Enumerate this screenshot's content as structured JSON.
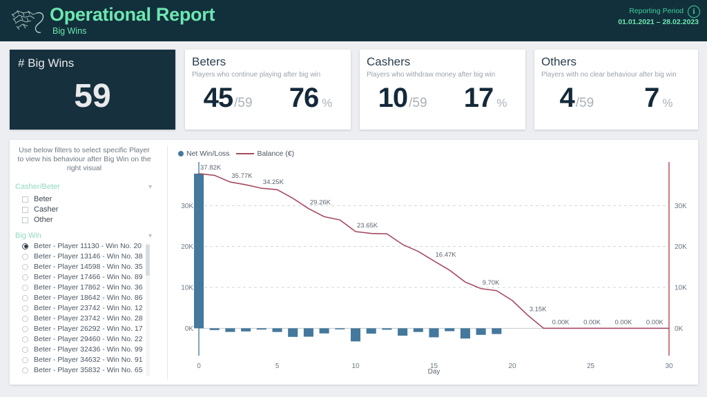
{
  "header": {
    "title": "Operational Report",
    "subtitle": "Big Wins",
    "logo_icon": "gecko-logo-icon",
    "reporting_period_label": "Reporting Period",
    "reporting_period_dates": "01.01.2021 – 28.02.2023",
    "info_icon": "i",
    "bg_color": "#12303c",
    "accent_color": "#6ee7b0"
  },
  "kpis": [
    {
      "title": "# Big Wins",
      "value": "59",
      "style": "dark"
    },
    {
      "title": "Beters",
      "subtitle": "Players who continue playing after big win",
      "count": "45",
      "count_unit": "/59",
      "percent": "76",
      "percent_unit": "%"
    },
    {
      "title": "Cashers",
      "subtitle": "Players who withdraw money after big win",
      "count": "10",
      "count_unit": "/59",
      "percent": "17",
      "percent_unit": "%"
    },
    {
      "title": "Others",
      "subtitle": "Players with no clear behaviour after big win",
      "count": "4",
      "count_unit": "/59",
      "percent": "7",
      "percent_unit": "%"
    }
  ],
  "filters": {
    "help_text": "Use below filters to select specific Player to view his behaviour after Big Win on the right visual",
    "groups": [
      {
        "label": "Casher/Beter",
        "chevron_icon": "chevron-down-icon",
        "options": [
          {
            "label": "Beter",
            "checked": false
          },
          {
            "label": "Casher",
            "checked": false
          },
          {
            "label": "Other",
            "checked": false
          }
        ]
      },
      {
        "label": "Big Win",
        "chevron_icon": "chevron-down-icon",
        "options": [
          {
            "label": "Beter - Player 11130 - Win No. 20",
            "selected": true
          },
          {
            "label": "Beter - Player 13146 - Win No. 38",
            "selected": false
          },
          {
            "label": "Beter - Player 14598 - Win No. 35",
            "selected": false
          },
          {
            "label": "Beter - Player 17466 - Win No. 89",
            "selected": false
          },
          {
            "label": "Beter - Player 17862 - Win No. 36",
            "selected": false
          },
          {
            "label": "Beter - Player 18642 - Win No. 86",
            "selected": false
          },
          {
            "label": "Beter - Player 23742 - Win No. 12",
            "selected": false
          },
          {
            "label": "Beter - Player 23742 - Win No. 28",
            "selected": false
          },
          {
            "label": "Beter - Player 26292 - Win No. 17",
            "selected": false
          },
          {
            "label": "Beter - Player 29460 - Win No. 22",
            "selected": false
          },
          {
            "label": "Beter - Player 32436 - Win No. 99",
            "selected": false
          },
          {
            "label": "Beter - Player 34632 - Win No. 91",
            "selected": false
          },
          {
            "label": "Beter - Player 35832 - Win No. 65",
            "selected": false
          }
        ]
      }
    ]
  },
  "chart_data": {
    "type": "bar",
    "title": "",
    "xlabel": "Day",
    "ylabel": "",
    "xlim": [
      0,
      30
    ],
    "ylim": [
      -5000,
      40000
    ],
    "xticks": [
      0,
      5,
      10,
      15,
      20,
      25,
      30
    ],
    "yticks": [
      0,
      10000,
      20000,
      30000
    ],
    "ytick_labels": [
      "0K",
      "10K",
      "20K",
      "30K"
    ],
    "right_ytick_labels": [
      "0K",
      "10K",
      "20K",
      "30K"
    ],
    "grid": true,
    "legend_position": "top-left",
    "bar_color": "#44789c",
    "line_color": "#a44a60",
    "series": [
      {
        "name": "Net Win/Loss",
        "type": "bar",
        "x": [
          0,
          1,
          2,
          3,
          4,
          5,
          6,
          7,
          8,
          9,
          10,
          11,
          12,
          13,
          14,
          15,
          16,
          17,
          18,
          19
        ],
        "values": [
          37820,
          -430,
          -880,
          -760,
          -310,
          -900,
          -2100,
          -2050,
          -1250,
          -200,
          -3200,
          -1300,
          -350,
          -1800,
          -900,
          -2200,
          -700,
          -2500,
          -1600,
          -1400
        ]
      },
      {
        "name": "Balance (€)",
        "type": "line",
        "x": [
          0,
          1,
          2,
          3,
          4,
          5,
          6,
          7,
          8,
          9,
          10,
          11,
          12,
          13,
          14,
          15,
          16,
          17,
          18,
          19,
          20,
          21,
          22,
          23,
          24,
          25,
          26,
          27,
          28,
          29,
          30
        ],
        "values": [
          37820,
          37400,
          35770,
          35100,
          34250,
          33900,
          31800,
          29260,
          27300,
          26500,
          23650,
          23200,
          23100,
          20500,
          18800,
          16470,
          14200,
          11300,
          9700,
          9200,
          6800,
          3150,
          0,
          0,
          0,
          0,
          0,
          0,
          0,
          0,
          0
        ]
      }
    ],
    "point_labels": [
      {
        "x": 0,
        "value": 37820,
        "text": "37.82K"
      },
      {
        "x": 2,
        "value": 35770,
        "text": "35.77K"
      },
      {
        "x": 4,
        "value": 34250,
        "text": "34.25K"
      },
      {
        "x": 7,
        "value": 29260,
        "text": "29.26K"
      },
      {
        "x": 10,
        "value": 23650,
        "text": "23.65K"
      },
      {
        "x": 15,
        "value": 16470,
        "text": "16.47K"
      },
      {
        "x": 18,
        "value": 9700,
        "text": "9.70K"
      },
      {
        "x": 21,
        "value": 3150,
        "text": "3.15K"
      },
      {
        "x": 23,
        "value": 0,
        "text": "0.00K"
      },
      {
        "x": 25,
        "value": 0,
        "text": "0.00K"
      },
      {
        "x": 27,
        "value": 0,
        "text": "0.00K"
      },
      {
        "x": 29,
        "value": 0,
        "text": "0.00K"
      }
    ],
    "legend": [
      {
        "label": "Net Win/Loss",
        "marker": "dot",
        "color": "#44789c"
      },
      {
        "label": "Balance (€)",
        "marker": "line",
        "color": "#a44a60"
      }
    ]
  }
}
